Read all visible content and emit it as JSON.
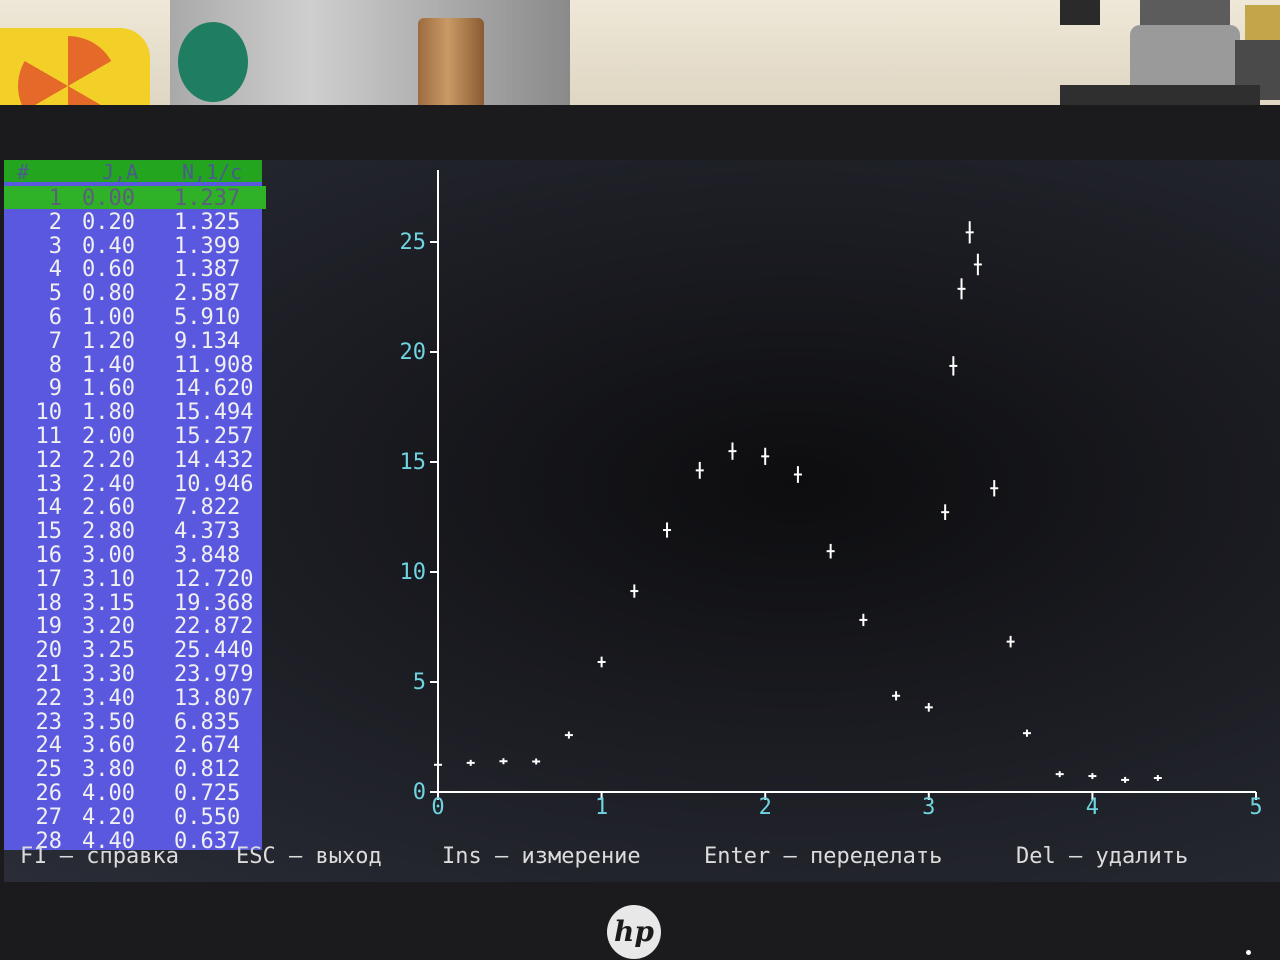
{
  "colors": {
    "screen_bg": "#1b1c22",
    "table_bg": "#5b58e0",
    "header_bg": "#23a51f",
    "axis_label": "#6fd3e0",
    "axis": "#ffffff",
    "points": "#ffffff"
  },
  "table": {
    "headers": {
      "n": "#",
      "j": "J,A",
      "v": "N,1/c"
    },
    "rows": [
      [
        "1",
        "0.00",
        "1.237"
      ],
      [
        "2",
        "0.20",
        "1.325"
      ],
      [
        "3",
        "0.40",
        "1.399"
      ],
      [
        "4",
        "0.60",
        "1.387"
      ],
      [
        "5",
        "0.80",
        "2.587"
      ],
      [
        "6",
        "1.00",
        "5.910"
      ],
      [
        "7",
        "1.20",
        "9.134"
      ],
      [
        "8",
        "1.40",
        "11.908"
      ],
      [
        "9",
        "1.60",
        "14.620"
      ],
      [
        "10",
        "1.80",
        "15.494"
      ],
      [
        "11",
        "2.00",
        "15.257"
      ],
      [
        "12",
        "2.20",
        "14.432"
      ],
      [
        "13",
        "2.40",
        "10.946"
      ],
      [
        "14",
        "2.60",
        "7.822"
      ],
      [
        "15",
        "2.80",
        "4.373"
      ],
      [
        "16",
        "3.00",
        "3.848"
      ],
      [
        "17",
        "3.10",
        "12.720"
      ],
      [
        "18",
        "3.15",
        "19.368"
      ],
      [
        "19",
        "3.20",
        "22.872"
      ],
      [
        "20",
        "3.25",
        "25.440"
      ],
      [
        "21",
        "3.30",
        "23.979"
      ],
      [
        "22",
        "3.40",
        "13.807"
      ],
      [
        "23",
        "3.50",
        "6.835"
      ],
      [
        "24",
        "3.60",
        "2.674"
      ],
      [
        "25",
        "3.80",
        "0.812"
      ],
      [
        "26",
        "4.00",
        "0.725"
      ],
      [
        "27",
        "4.20",
        "0.550"
      ],
      [
        "28",
        "4.40",
        "0.637"
      ]
    ]
  },
  "chart_data": {
    "type": "scatter",
    "x_ticks": [
      "0",
      "1",
      "2",
      "3",
      "4",
      "5"
    ],
    "y_ticks": [
      "0",
      "5",
      "10",
      "15",
      "20",
      "25"
    ],
    "xlim": [
      0,
      5
    ],
    "ylim": [
      0,
      27
    ],
    "grid": false,
    "series": [
      {
        "x": [
          0.0,
          0.2,
          0.4,
          0.6,
          0.8,
          1.0,
          1.2,
          1.4,
          1.6,
          1.8,
          2.0,
          2.2,
          2.4,
          2.6,
          2.8,
          3.0,
          3.1,
          3.15,
          3.2,
          3.25,
          3.3,
          3.4,
          3.5,
          3.6,
          3.8,
          4.0,
          4.2,
          4.4
        ],
        "y": [
          1.237,
          1.325,
          1.399,
          1.387,
          2.587,
          5.91,
          9.134,
          11.908,
          14.62,
          15.494,
          15.257,
          14.432,
          10.946,
          7.822,
          4.373,
          3.848,
          12.72,
          19.368,
          22.872,
          25.44,
          23.979,
          13.807,
          6.835,
          2.674,
          0.812,
          0.725,
          0.55,
          0.637
        ]
      }
    ]
  },
  "footer": {
    "help": "F1 – справка",
    "exit": "ESC – выход",
    "measure": "Ins – измерение",
    "redo": "Enter – переделать",
    "delete": "Del – удалить"
  },
  "brand": "hp"
}
